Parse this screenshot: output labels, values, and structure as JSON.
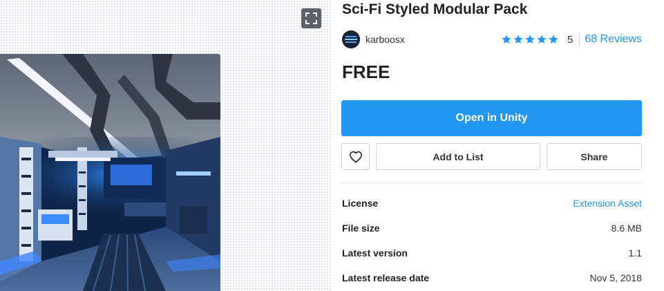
{
  "product": {
    "title": "Sci-Fi Styled Modular Pack",
    "publisher": "karboosx",
    "rating": {
      "stars": 5,
      "max_stars": 5,
      "value": "5",
      "reviews_label": "68 Reviews"
    },
    "price": "FREE"
  },
  "media": {
    "fullscreen_icon": "fullscreen-icon",
    "preview_image": "sci-fi corridor render"
  },
  "actions": {
    "primary_label": "Open in Unity",
    "favorite_icon": "heart-icon",
    "add_to_list_label": "Add to List",
    "share_label": "Share"
  },
  "details": [
    {
      "label": "License",
      "value": "Extension Asset",
      "is_link": true
    },
    {
      "label": "File size",
      "value": "8.6 MB",
      "is_link": false
    },
    {
      "label": "Latest version",
      "value": "1.1",
      "is_link": false
    },
    {
      "label": "Latest release date",
      "value": "Nov 5, 2018",
      "is_link": false
    }
  ],
  "colors": {
    "accent": "#2196f3",
    "star": "#2196f3",
    "text": "#212121",
    "border": "#cdd2d8"
  }
}
